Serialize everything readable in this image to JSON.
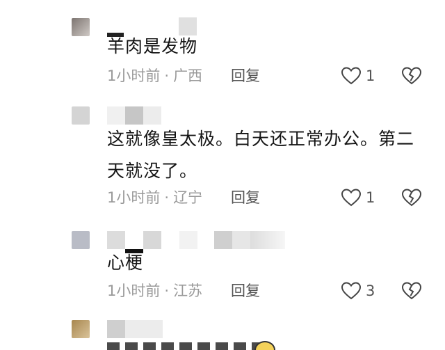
{
  "comments": [
    {
      "text": "羊肉是发物",
      "time": "1小时前",
      "separator": "·",
      "location": "广西",
      "reply_label": "回复",
      "like_count": "1"
    },
    {
      "text": "这就像皇太极。白天还正常办公。第二天就没了。",
      "time": "1小时前",
      "separator": "·",
      "location": "辽宁",
      "reply_label": "回复",
      "like_count": "1"
    },
    {
      "text": "心梗",
      "time": "1小时前",
      "separator": "·",
      "location": "江苏",
      "reply_label": "回复",
      "like_count": "3"
    },
    {
      "text": "",
      "time": "",
      "separator": "",
      "location": "",
      "reply_label": "",
      "like_count": ""
    }
  ],
  "icons": {
    "like": "heart-outline-icon",
    "dislike": "broken-heart-icon"
  },
  "colors": {
    "text": "#141414",
    "meta": "#9a9a9a",
    "icon": "#444444"
  }
}
